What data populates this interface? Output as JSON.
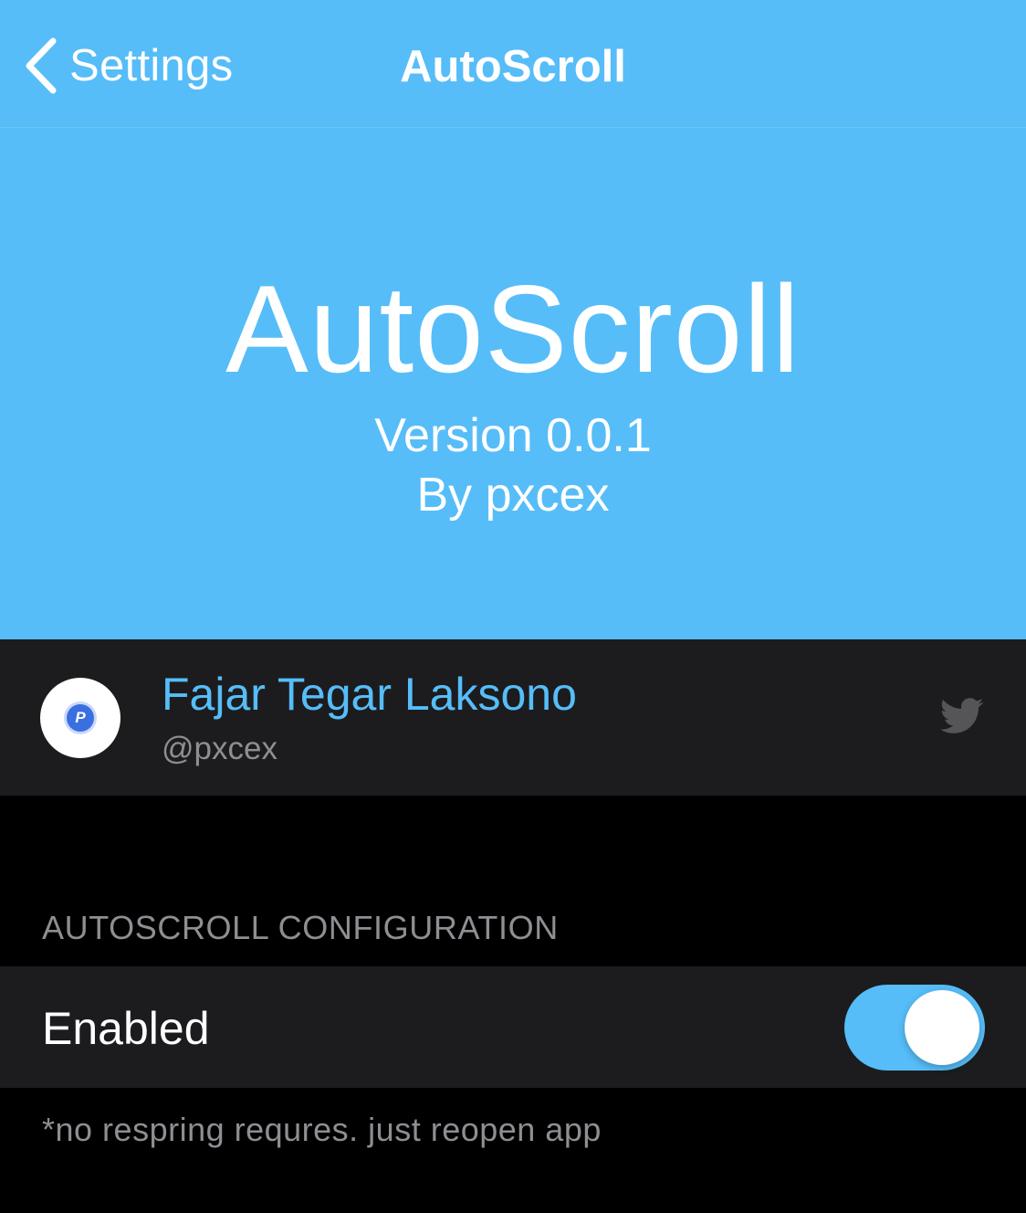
{
  "navbar": {
    "back_label": "Settings",
    "back_icon": "chevron-left-icon",
    "title": "AutoScroll"
  },
  "header": {
    "title": "AutoScroll",
    "version": "Version 0.0.1",
    "author": "By pxcex"
  },
  "profile": {
    "name": "Fajar Tegar Laksono",
    "handle": "@pxcex",
    "avatar_letter": "P",
    "link_icon": "twitter-icon"
  },
  "config": {
    "section_title": "AUTOSCROLL CONFIGURATION",
    "enabled_label": "Enabled",
    "enabled_value": true,
    "footer": "*no respring requres. just reopen app"
  },
  "colors": {
    "accent": "#56bdf8",
    "background": "#000000",
    "cell": "#1c1c1e",
    "secondary_text": "#8e8e93"
  }
}
